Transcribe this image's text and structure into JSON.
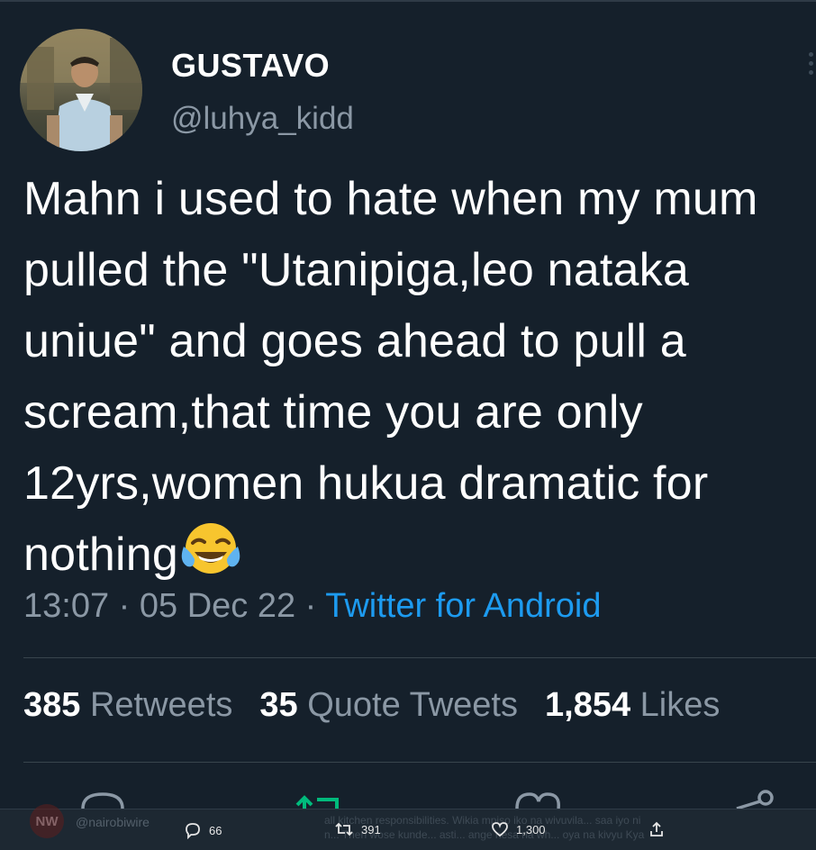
{
  "tweet": {
    "display_name": "GUSTAVO",
    "handle": "@luhya_kidd",
    "text": "Mahn i used to hate when my mum pulled the \"Utanipiga,leo nataka uniue\" and goes ahead to pull a scream,that time you are only 12yrs,women hukua dramatic for nothing",
    "emoji": "face-with-tears-of-joy",
    "time": "13:07",
    "date": "05 Dec 22",
    "source": "Twitter for Android",
    "separator": "·"
  },
  "stats": {
    "retweets_count": "385",
    "retweets_label": "Retweets",
    "quotes_count": "35",
    "quotes_label": "Quote Tweets",
    "likes_count": "1,854",
    "likes_label": "Likes"
  },
  "bottom_bar": {
    "logo_text": "NW",
    "account_handle": "@nairobiwire",
    "ghost_line_1": "all kitchen responsibilities. Wikia mpiso iko na wivuvila... saa iyo ni",
    "ghost_line_2": "n... Then wose kunde... asti... ange nesa na wh... oya na kivyu Kya",
    "replies": "66",
    "retweets": "391",
    "likes": "1,300"
  },
  "colors": {
    "background": "#15202b",
    "text_primary": "#ffffff",
    "text_secondary": "#8b98a5",
    "link": "#1d9bf0",
    "retweet_green": "#00ba7c"
  }
}
